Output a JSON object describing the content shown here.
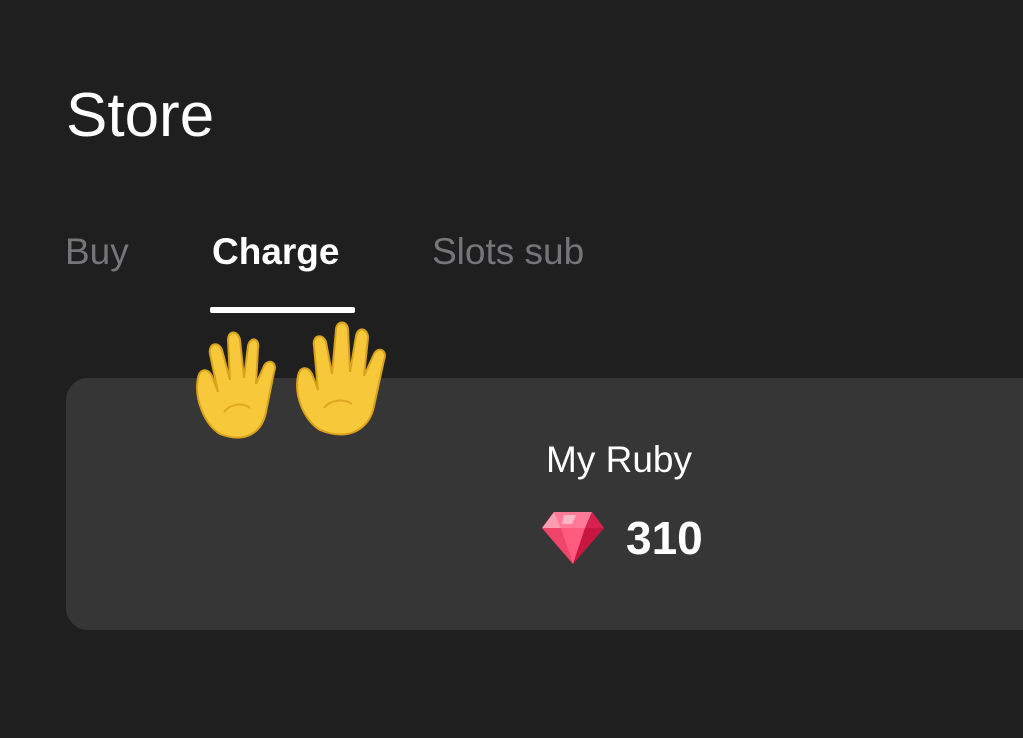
{
  "header": {
    "title": "Store"
  },
  "tabs": [
    {
      "label": "Buy",
      "active": false
    },
    {
      "label": "Charge",
      "active": true
    },
    {
      "label": "Slots sub",
      "active": false
    }
  ],
  "ruby_card": {
    "label": "My Ruby",
    "count": "310",
    "icon": "gem-icon"
  },
  "decoration": {
    "icon": "raised-hands-icon"
  },
  "colors": {
    "background": "#1f1f1f",
    "card": "#363636",
    "tab_inactive": "#76767a",
    "tab_active": "#ffffff",
    "gem": "#e8335a",
    "hands": "#f7c83a"
  }
}
